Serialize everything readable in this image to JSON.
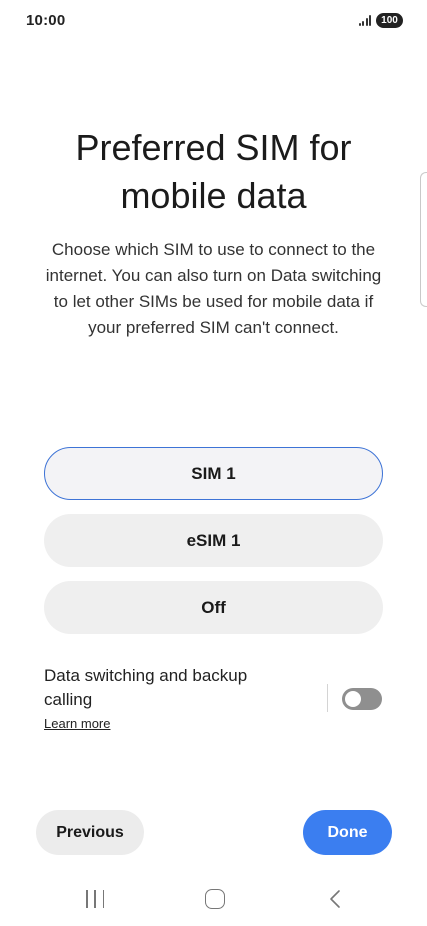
{
  "status_bar": {
    "time": "10:00",
    "battery": "100"
  },
  "header": {
    "title": "Preferred SIM for mobile data",
    "description": "Choose which SIM to use to connect to the internet. You can also turn on Data switching to let other SIMs be used for mobile data if your preferred SIM can't connect."
  },
  "options": [
    {
      "label": "SIM 1",
      "selected": true
    },
    {
      "label": "eSIM 1",
      "selected": false
    },
    {
      "label": "Off",
      "selected": false
    }
  ],
  "data_switching": {
    "label": "Data switching and backup calling",
    "learn_more": "Learn more",
    "enabled": false
  },
  "footer": {
    "previous_label": "Previous",
    "done_label": "Done"
  },
  "colors": {
    "accent": "#3b7ef0",
    "selected_border": "#3d73d6",
    "toggle_off": "#8f8f8f"
  },
  "nav_bar": {
    "icons": [
      "recents-icon",
      "home-icon",
      "back-icon"
    ]
  }
}
